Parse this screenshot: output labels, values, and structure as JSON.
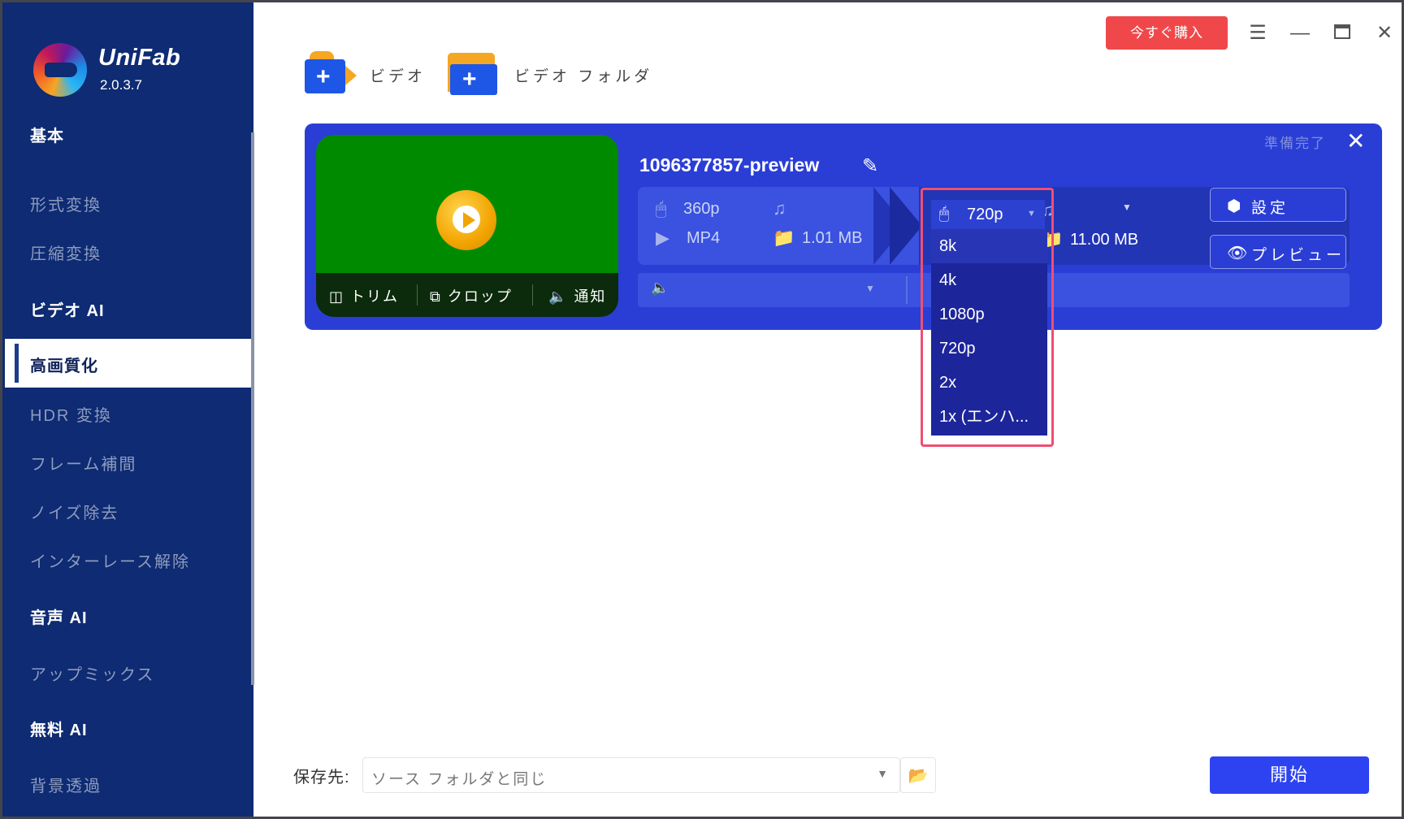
{
  "app": {
    "name": "UniFab",
    "version": "2.0.3.7",
    "accent": "#2a3ed6",
    "sidebar_bg": "#0e2b73"
  },
  "sidebar": {
    "sections": [
      {
        "title": "基本",
        "items": [
          "形式変換",
          "圧縮変換"
        ]
      },
      {
        "title": "ビデオ AI",
        "items": [
          "高画質化",
          "HDR 変換",
          "フレーム補間",
          "ノイズ除去",
          "インターレース解除"
        ]
      },
      {
        "title": "音声 AI",
        "items": [
          "アップミックス"
        ]
      },
      {
        "title": "無料 AI",
        "items": [
          "背景透過"
        ]
      }
    ],
    "active_item": "高画質化"
  },
  "titlebar": {
    "buy_label": "今すぐ購入",
    "icons": [
      "menu-icon",
      "minimize-icon",
      "maximize-icon",
      "close-icon"
    ]
  },
  "toolbar": {
    "add_video_label": "ビデオ",
    "add_folder_label": "ビデオ フォルダ"
  },
  "task": {
    "filename": "1096377857-preview",
    "status": "準備完了",
    "thumbnail_bg": "#008a00",
    "thumb_actions": {
      "trim": "トリム",
      "crop": "クロップ",
      "notify": "通知"
    },
    "source": {
      "resolution": "360p",
      "format": "MP4",
      "size": "1.01 MB"
    },
    "output": {
      "resolution": "720p",
      "size": "11.00 MB"
    },
    "settings_label": "設定",
    "preview_label": "プレビュー"
  },
  "resolution_dropdown": {
    "selected": "720p",
    "options": [
      "8k",
      "4k",
      "1080p",
      "720p",
      "2x",
      "1x (エンハ..."
    ],
    "highlighted": "8k",
    "outline_color": "#ef4f72"
  },
  "footer": {
    "save_label": "保存先:",
    "save_value": "ソース フォルダと同じ",
    "start_label": "開始"
  }
}
